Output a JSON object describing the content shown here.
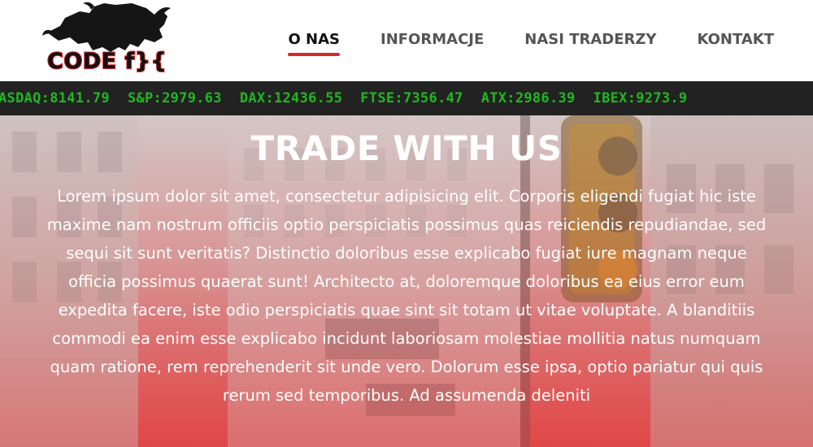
{
  "brand": {
    "logo_text": "CODE f}{",
    "accent": "#d7282f"
  },
  "nav": {
    "items": [
      {
        "label": "O NAS",
        "active": true
      },
      {
        "label": "INFORMACJE",
        "active": false
      },
      {
        "label": "NASI TRADERZY",
        "active": false
      },
      {
        "label": "KONTAKT",
        "active": false
      }
    ]
  },
  "ticker": {
    "color": "#1fb81f",
    "items": [
      "ASDAQ:8141.79",
      "S&P:2979.63",
      "DAX:12436.55",
      "FTSE:7356.47",
      "ATX:2986.39",
      "IBEX:9273.9"
    ]
  },
  "hero": {
    "title": "TRADE WITH US",
    "body": "Lorem ipsum dolor sit amet, consectetur adipisicing elit. Corporis eligendi fugiat hic iste maxime nam nostrum officiis optio perspiciatis possimus quas reiciendis repudiandae, sed sequi sit sunt veritatis? Distinctio doloribus esse explicabo fugiat iure magnam neque officia possimus quaerat sunt! Architecto at, doloremque doloribus ea eius error eum expedita facere, iste odio perspiciatis quae sint sit totam ut vitae voluptate. A blanditiis commodi ea enim esse explicabo incidunt laboriosam molestiae mollitia natus numquam quam ratione, rem reprehenderit sit unde vero. Dolorum esse ipsa, optio pariatur qui quis rerum sed temporibus. Ad assumenda deleniti"
  }
}
